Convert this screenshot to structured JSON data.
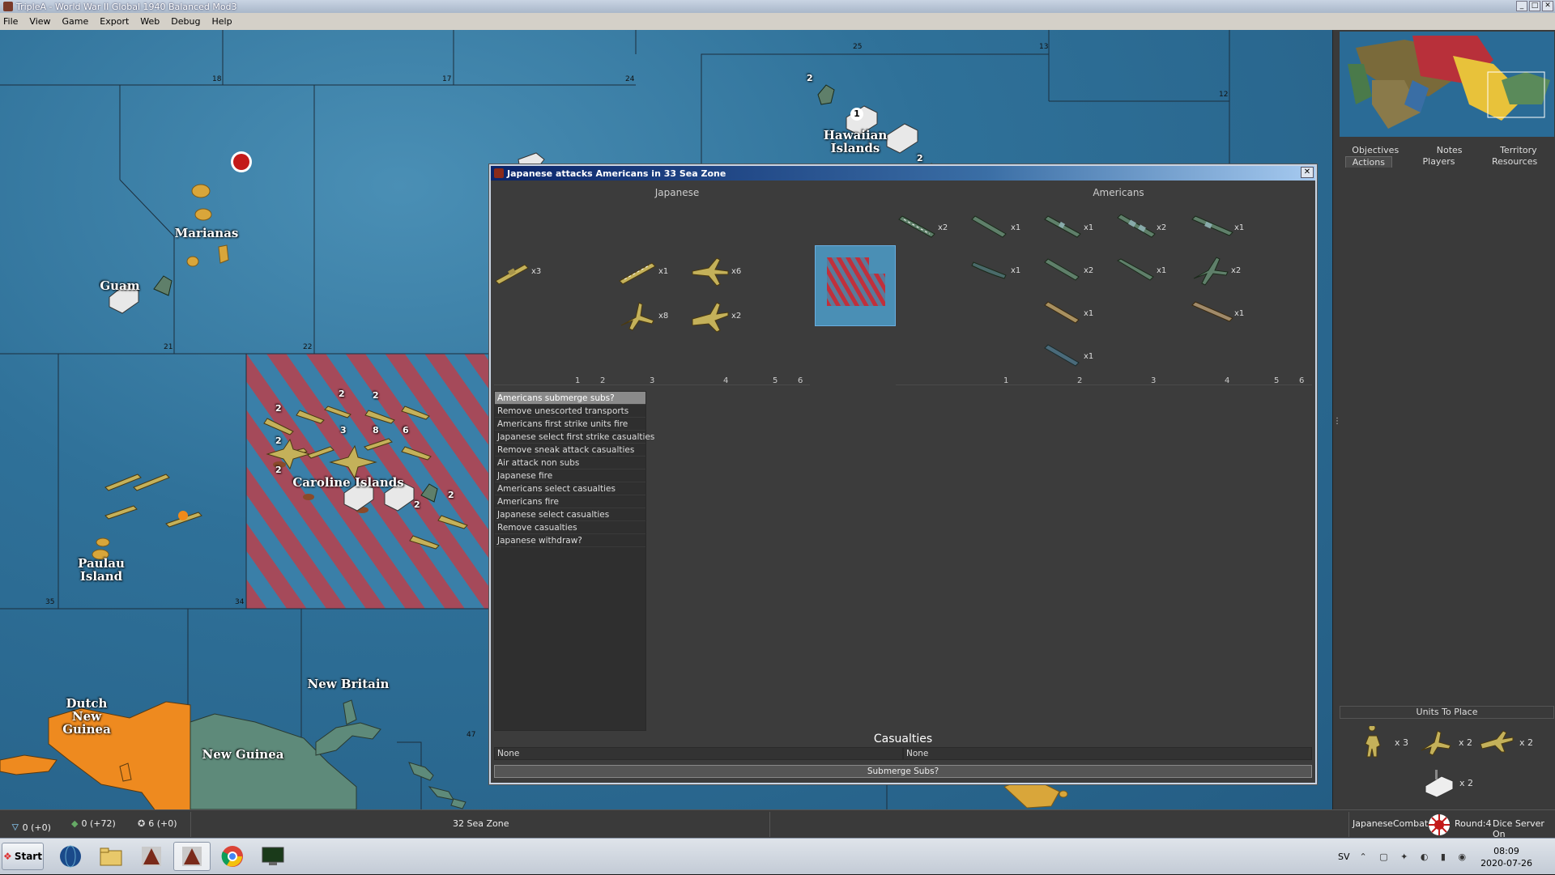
{
  "window": {
    "title": "TripleA - World War II Global 1940 Balanced Mod3"
  },
  "menu": [
    "File",
    "View",
    "Game",
    "Export",
    "Web",
    "Debug",
    "Help"
  ],
  "map": {
    "labels": {
      "marianas": "Marianas",
      "guam": "Guam",
      "hawaiian": "Hawaiian\nIslands",
      "caroline": "Caroline Islands",
      "paulau": "Paulau\nIsland",
      "dutch_new_guinea": "Dutch\nNew\nGuinea",
      "new_guinea": "New Guinea",
      "new_britain": "New Britain"
    },
    "zone_numbers": [
      "18",
      "17",
      "24",
      "25",
      "13",
      "12",
      "21",
      "22",
      "35",
      "34",
      "47"
    ],
    "stack_counts": {
      "hawaii_inf": "2",
      "hawaii_factory": "1",
      "hawaii_planes": "2",
      "car1": "2",
      "car2": "2",
      "car3": "2",
      "car4": "2",
      "car5": "3",
      "car6": "8",
      "car7": "6",
      "car8": "2",
      "car9": "2",
      "car10": "2"
    }
  },
  "right_panel": {
    "tabs_row1": [
      "Objectives",
      "Notes",
      "Territory"
    ],
    "tabs_row2": [
      "Actions",
      "Players",
      "Resources"
    ],
    "active_tab": "Actions",
    "units_to_place_label": "Units To Place",
    "units_to_place": [
      {
        "icon": "infantry-icon",
        "count": "x 3"
      },
      {
        "icon": "fighter-icon",
        "count": "x 2"
      },
      {
        "icon": "bomber-icon",
        "count": "x 2"
      },
      {
        "icon": "factory-icon",
        "count": "x 2"
      }
    ]
  },
  "statusbar": {
    "tech": "0 (+0)",
    "pus": "0 (+72)",
    "vp": "6 (+0)",
    "zone": "32 Sea Zone",
    "player": "Japanese",
    "phase": "Combat",
    "round": "Round:4",
    "dice": "Dice Server On"
  },
  "taskbar": {
    "start": "Start",
    "lang": "SV",
    "time": "08:09",
    "date": "2020-07-26"
  },
  "battle": {
    "title": "Japanese attacks Americans in 33 Sea Zone",
    "attacker": "Japanese",
    "defender": "Americans",
    "attacker_units": [
      {
        "unit": "transport",
        "count": "x3"
      },
      {
        "unit": "carrier",
        "count": "x1"
      },
      {
        "unit": "tactical-bomber",
        "count": "x6"
      },
      {
        "unit": "fighter",
        "count": "x8"
      },
      {
        "unit": "bomber",
        "count": "x2"
      }
    ],
    "defender_units": [
      {
        "unit": "carrier",
        "count": "x2"
      },
      {
        "unit": "destroyer",
        "count": "x1"
      },
      {
        "unit": "cruiser",
        "count": "x1"
      },
      {
        "unit": "battleship",
        "count": "x2"
      },
      {
        "unit": "battleship",
        "count": "x1"
      },
      {
        "unit": "submarine",
        "count": "x1"
      },
      {
        "unit": "destroyer",
        "count": "x2"
      },
      {
        "unit": "cruiser",
        "count": "x1"
      },
      {
        "unit": "fighter",
        "count": "x2"
      },
      {
        "unit": "destroyer",
        "count": "x1"
      },
      {
        "unit": "battleship",
        "count": "x1"
      },
      {
        "unit": "destroyer",
        "count": "x1"
      }
    ],
    "dice_columns": [
      "1",
      "2",
      "3",
      "4",
      "5",
      "6"
    ],
    "steps": [
      "Americans submerge subs?",
      "Remove unescorted transports",
      "Americans first strike units fire",
      "Japanese select first strike casualties",
      "Remove sneak attack casualties",
      "Air attack non subs",
      "Japanese fire",
      "Americans select casualties",
      "Americans fire",
      "Japanese select casualties",
      "Remove casualties",
      "Japanese withdraw?"
    ],
    "selected_step": "Americans submerge subs?",
    "casualties_label": "Casualties",
    "casualties_left": "None",
    "casualties_right": "None",
    "action_button": "Submerge Subs?"
  },
  "colors": {
    "japanese": "#c4b15a",
    "american": "#5f7f6a",
    "sea": "#2f7199",
    "battle_stripe": "#c0303c",
    "dialog_bg": "#3c3c3c"
  }
}
